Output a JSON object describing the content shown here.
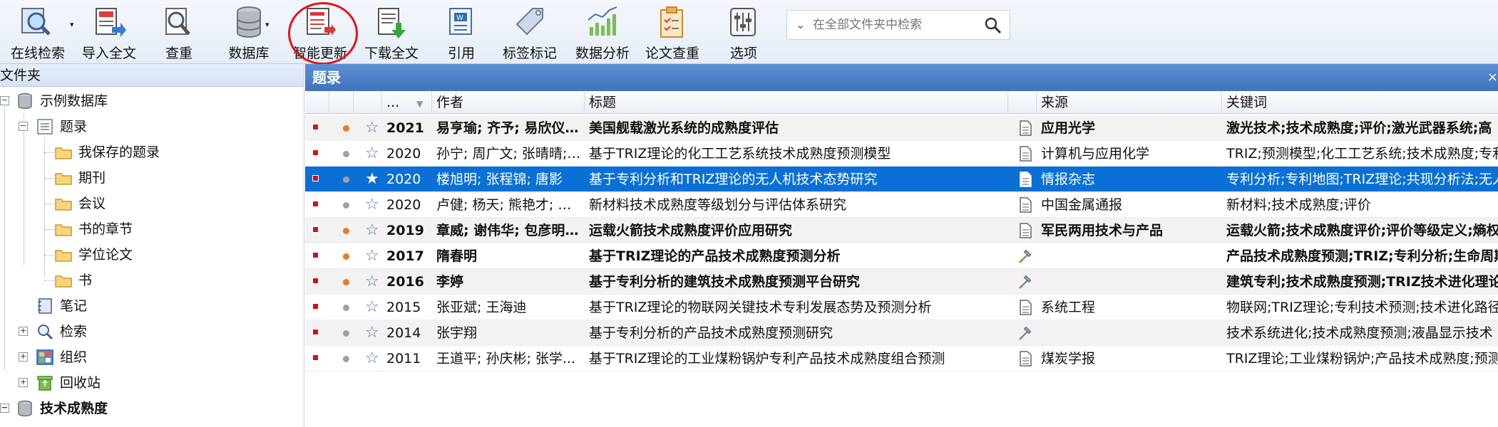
{
  "toolbar": {
    "buttons": [
      {
        "label": "在线检索",
        "icon": "online-search-icon"
      },
      {
        "label": "导入全文",
        "icon": "import-fulltext-icon"
      },
      {
        "label": "查重",
        "icon": "check-duplicates-icon"
      },
      {
        "label": "数据库",
        "icon": "database-icon"
      },
      {
        "label": "智能更新",
        "icon": "smart-update-icon"
      },
      {
        "label": "下载全文",
        "icon": "download-fulltext-icon"
      },
      {
        "label": "引用",
        "icon": "cite-icon"
      },
      {
        "label": "标签标记",
        "icon": "tag-icon"
      },
      {
        "label": "数据分析",
        "icon": "data-analysis-icon"
      },
      {
        "label": "论文查重",
        "icon": "paper-check-icon"
      },
      {
        "label": "选项",
        "icon": "options-icon"
      }
    ],
    "search": {
      "placeholder": "在全部文件夹中检索"
    }
  },
  "left_panel": {
    "title": "文件夹",
    "tree": [
      {
        "label": "示例数据库",
        "icon": "database-icon"
      },
      {
        "label": "题录",
        "icon": "records-icon"
      },
      {
        "label": "我保存的题录",
        "icon": "folder-icon"
      },
      {
        "label": "期刊",
        "icon": "folder-icon"
      },
      {
        "label": "会议",
        "icon": "folder-icon"
      },
      {
        "label": "书的章节",
        "icon": "folder-icon"
      },
      {
        "label": "学位论文",
        "icon": "folder-icon"
      },
      {
        "label": "书",
        "icon": "folder-icon"
      },
      {
        "label": "笔记",
        "icon": "notebook-icon"
      },
      {
        "label": "检索",
        "icon": "magnifier-icon"
      },
      {
        "label": "组织",
        "icon": "organize-icon"
      },
      {
        "label": "回收站",
        "icon": "recycle-bin-icon"
      },
      {
        "label": "技术成熟度",
        "icon": "database-icon"
      }
    ]
  },
  "main": {
    "title": "题录",
    "close": "×",
    "columns": {
      "year": "...",
      "author": "作者",
      "title": "标题",
      "source": "来源",
      "keywords": "关键词"
    },
    "rows": [
      {
        "year": "2021",
        "author": "易亨瑜; 齐予; 易欣仪; ...",
        "title": "美国舰载激光系统的成熟度评估",
        "source": "应用光学",
        "keywords": "激光技术;技术成熟度;评价;激光武器系统;高",
        "bold": true,
        "dot": "#f07820",
        "attach": "doc"
      },
      {
        "year": "2020",
        "author": "孙宁; 周广文; 张晴晴; ...",
        "title": "基于TRIZ理论的化工工艺系统技术成熟度预测模型",
        "source": "计算机与应用化学",
        "keywords": "TRIZ;预测模型;化工工艺系统;技术成熟度;专利",
        "bold": false,
        "dot": "#a0a0a0",
        "attach": "doc"
      },
      {
        "year": "2020",
        "author": "楼旭明; 张程锦; 唐影",
        "title": "基于专利分析和TRIZ理论的无人机技术态势研究",
        "source": "情报杂志",
        "keywords": "专利分析;专利地图;TRIZ理论;共现分析法;无人",
        "bold": false,
        "dot": "#a0a0a0",
        "attach": "doc",
        "selected": true
      },
      {
        "year": "2020",
        "author": "卢健; 杨天; 熊艳才; 张...",
        "title": "新材料技术成熟度等级划分与评估体系研究",
        "source": "中国金属通报",
        "keywords": "新材料;技术成熟度;评价",
        "bold": false,
        "dot": "#a0a0a0",
        "attach": "doc"
      },
      {
        "year": "2019",
        "author": "章威; 谢伟华; 包彦明; ...",
        "title": "运载火箭技术成熟度评价应用研究",
        "source": "军民两用技术与产品",
        "keywords": "运载火箭;技术成熟度评价;评价等级定义;熵权",
        "bold": true,
        "dot": "#f07820",
        "attach": "doc"
      },
      {
        "year": "2017",
        "author": "隋春明",
        "title": "基于TRIZ理论的产品技术成熟度预测分析",
        "source": "",
        "keywords": "产品技术成熟度预测;TRIZ;专利分析;生命周期",
        "bold": true,
        "dot": "#f07820",
        "attach": "link"
      },
      {
        "year": "2016",
        "author": "李婷",
        "title": "基于专利分析的建筑技术成熟度预测平台研究",
        "source": "",
        "keywords": "建筑专利;技术成熟度预测;TRIZ技术进化理论",
        "bold": true,
        "dot": "#f07820",
        "attach": "link"
      },
      {
        "year": "2015",
        "author": "张亚斌; 王海迪",
        "title": "基于TRIZ理论的物联网关键技术专利发展态势及预测分析",
        "source": "系统工程",
        "keywords": "物联网;TRIZ理论;专利技术预测;技术进化路径",
        "bold": false,
        "dot": "#a0a0a0",
        "attach": "doc"
      },
      {
        "year": "2014",
        "author": "张宇翔",
        "title": "基于专利分析的产品技术成熟度预测研究",
        "source": "",
        "keywords": "技术系统进化;技术成熟度预测;液晶显示技术",
        "bold": false,
        "dot": "#a0a0a0",
        "attach": "link"
      },
      {
        "year": "2011",
        "author": "王道平; 孙庆彬; 张学...",
        "title": "基于TRIZ理论的工业煤粉锅炉专利产品技术成熟度组合预测",
        "source": "煤炭学报",
        "keywords": "TRIZ理论;工业煤粉锅炉;产品技术成熟度;预测",
        "bold": false,
        "dot": "#a0a0a0",
        "attach": "doc"
      }
    ]
  }
}
